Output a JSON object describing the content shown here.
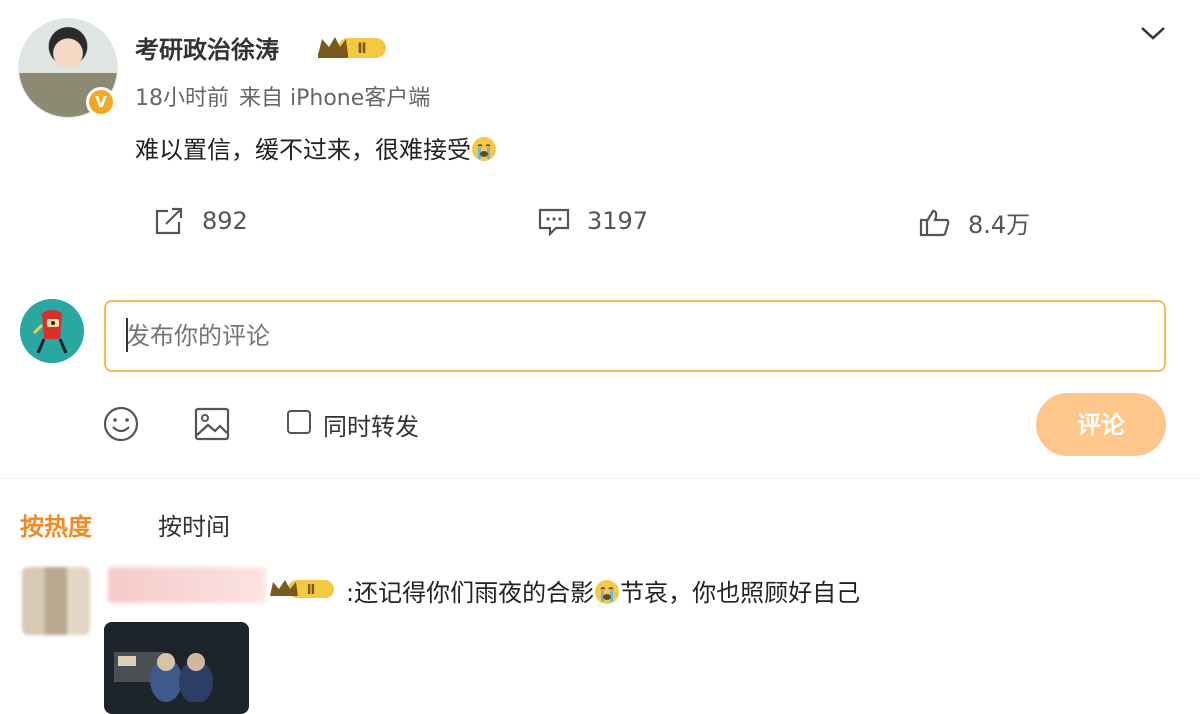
{
  "post": {
    "author": "考研政治徐涛",
    "vip_level": "Ⅱ",
    "verified_mark": "V",
    "time": "18小时前",
    "source": "来自 iPhone客户端",
    "text": "难以置信，缓不过来，很难接受",
    "text_emoji": "crying-face-icon"
  },
  "actions": {
    "reposts": "892",
    "comments": "3197",
    "likes": "8.4万"
  },
  "composer": {
    "placeholder": "发布你的评论",
    "also_repost_label": "同时转发",
    "submit_label": "评论"
  },
  "sort": {
    "hot_label": "按热度",
    "time_label": "按时间",
    "active": "按热度"
  },
  "comments": [
    {
      "vip_level": "Ⅱ",
      "text_before_emoji": ":还记得你们雨夜的合影",
      "emoji": "crying-face-icon",
      "text_after_emoji": "节哀，你也照顾好自己"
    }
  ],
  "colors": {
    "accent_orange": "#f08a24",
    "input_border": "#f7b95a",
    "submit_bg": "#fdc68a",
    "vip_gold": "#f5c842"
  }
}
